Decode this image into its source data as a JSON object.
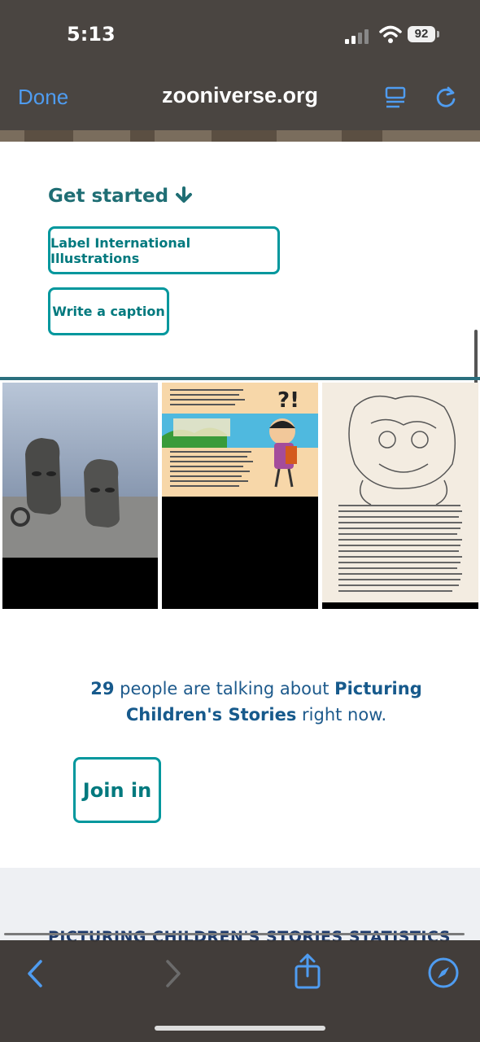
{
  "status_bar": {
    "time": "5:13",
    "battery": "92"
  },
  "browser": {
    "done_label": "Done",
    "url": "zooniverse.org"
  },
  "get_started": {
    "heading": "Get started",
    "workflows": [
      "Label International Illustrations",
      "Write a caption"
    ]
  },
  "talk": {
    "count": "29",
    "text_1": " people are talking about ",
    "project": "Picturing Children's Stories",
    "text_2": " right now.",
    "join_label": "Join in"
  },
  "stats": {
    "title": "PICTURING CHILDREN'S STORIES STATISTICS"
  },
  "colors": {
    "accent": "#00979d",
    "heading": "#1f6e74",
    "link_text": "#1d5a8c",
    "browser_chrome": "#4a4541",
    "ios_blue": "#4f9cf0"
  },
  "icons": [
    "signal-icon",
    "wifi-icon",
    "battery-icon",
    "reader-icon",
    "reload-icon",
    "arrow-down-icon",
    "back-icon",
    "forward-icon",
    "share-icon",
    "compass-icon"
  ]
}
